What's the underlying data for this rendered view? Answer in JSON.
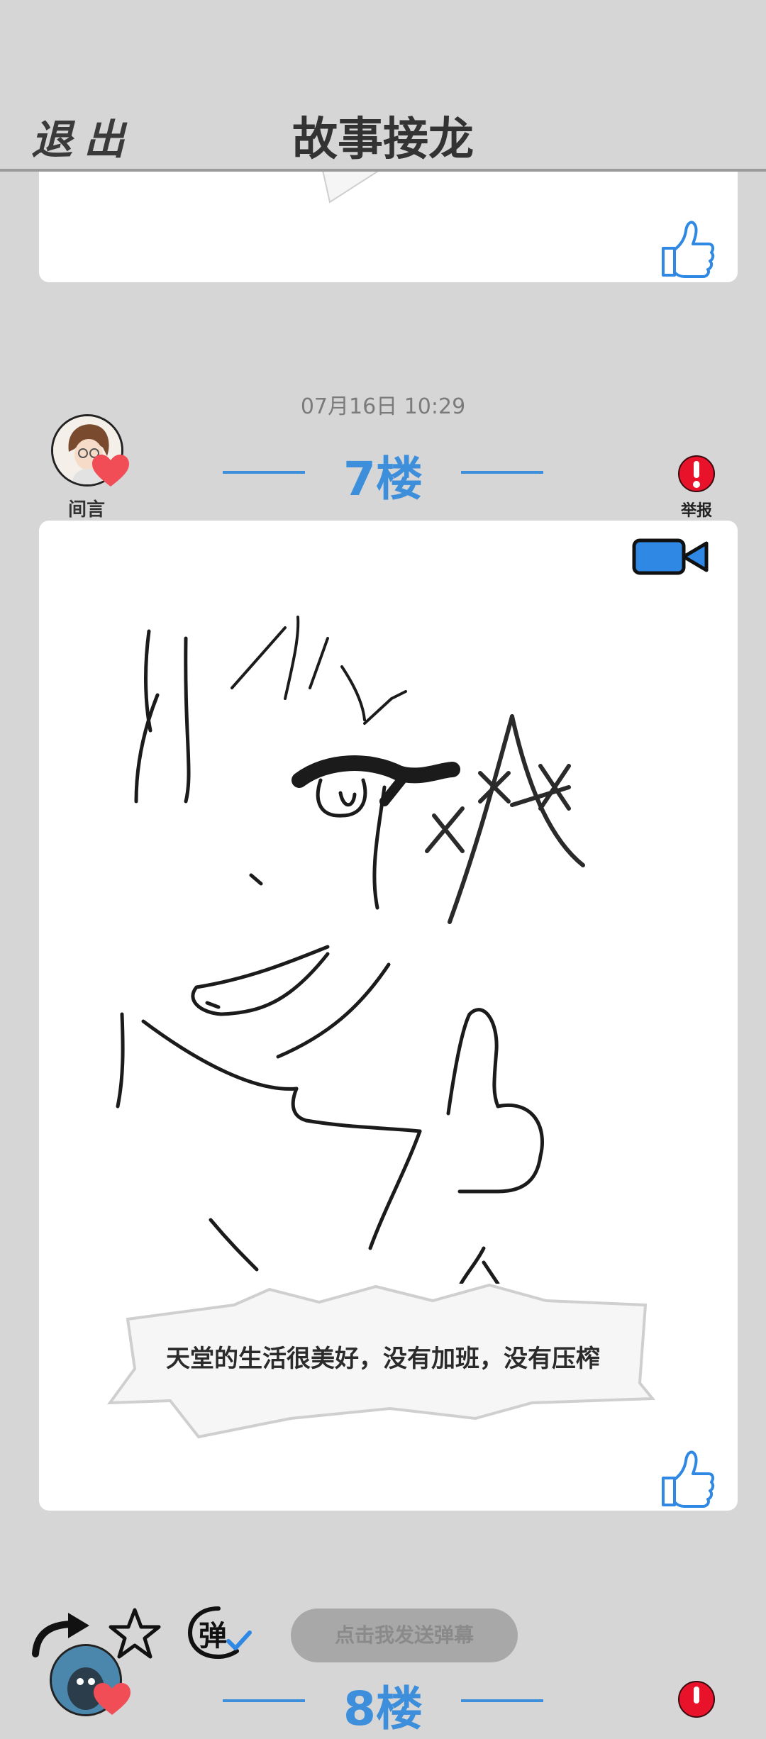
{
  "header": {
    "exit_label": "退出",
    "title": "故事接龙"
  },
  "posts": [
    {
      "timestamp": "07月16日  10:29",
      "floor": "7楼",
      "author": "间言",
      "report_label": "举报",
      "caption": "天堂的生活很美好，没有加班，没有压榨"
    },
    {
      "floor": "8楼"
    }
  ],
  "toolbar": {
    "danmaku_placeholder": "点击我发送弹幕",
    "danmaku_icon_char": "弹"
  },
  "colors": {
    "accent_blue": "#3d8fdc",
    "report_red": "#e8132a",
    "background": "#d6d6d6"
  },
  "icons": [
    "thumbs-up-icon",
    "video-camera-icon",
    "exclamation-icon",
    "heart-icon",
    "share-arrow-icon",
    "star-icon",
    "danmaku-icon"
  ]
}
